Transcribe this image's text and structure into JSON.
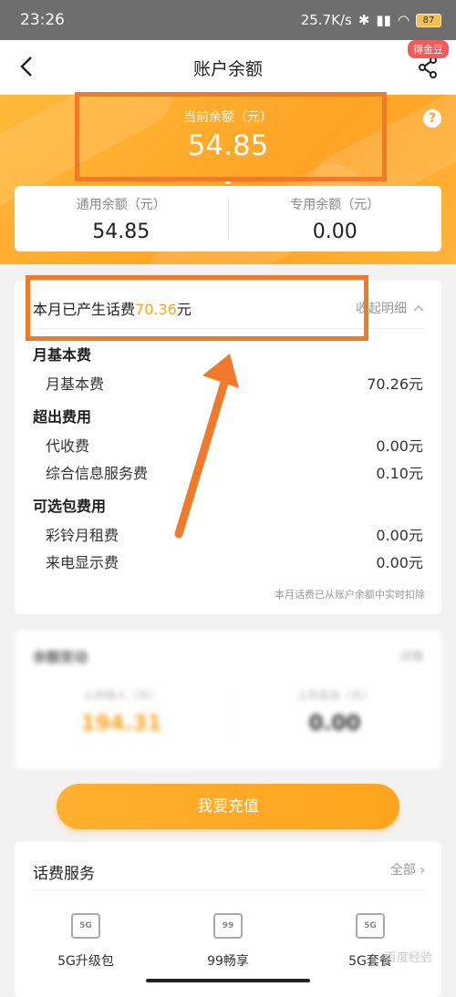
{
  "status_bar": {
    "time": "23:26",
    "speed": "25.7K/s",
    "battery": "87"
  },
  "nav": {
    "title": "账户余额",
    "badge": "得金豆"
  },
  "hero": {
    "current_label": "当前余额（元）",
    "current_value": "54.85",
    "general_label": "通用余额（元）",
    "general_value": "54.85",
    "special_label": "专用余额（元）",
    "special_value": "0.00"
  },
  "bill": {
    "summary_prefix": "本月已产生话费",
    "summary_amount": "70.36",
    "summary_suffix": "元",
    "collapse_label": "收起明细",
    "sections": [
      {
        "title": "月基本费",
        "rows": [
          {
            "name": "月基本费",
            "value": "70.26元"
          }
        ]
      },
      {
        "title": "超出费用",
        "rows": [
          {
            "name": "代收费",
            "value": "0.00元"
          },
          {
            "name": "综合信息服务费",
            "value": "0.10元"
          }
        ]
      },
      {
        "title": "可选包费用",
        "rows": [
          {
            "name": "彩铃月租费",
            "value": "0.00元"
          },
          {
            "name": "来电显示费",
            "value": "0.00元"
          }
        ]
      }
    ],
    "note": "本月话费已从账户余额中实时扣除"
  },
  "change": {
    "title": "余额变动",
    "more": "详情",
    "income_label": "上月收入（元）",
    "income_value": "194.31",
    "expense_label": "上月支出（元）",
    "expense_value": "0.00"
  },
  "recharge_label": "我要充值",
  "service": {
    "title": "话费服务",
    "all_label": "全部",
    "items": [
      {
        "name": "5G升级包",
        "icon": "5G"
      },
      {
        "name": "99畅享",
        "icon": "99"
      },
      {
        "name": "5G套餐",
        "icon": "5G"
      }
    ]
  },
  "watermark": "百度经验",
  "colors": {
    "accent": "#ffa325",
    "highlight": "#f07a2a",
    "amount": "#f5a623"
  }
}
